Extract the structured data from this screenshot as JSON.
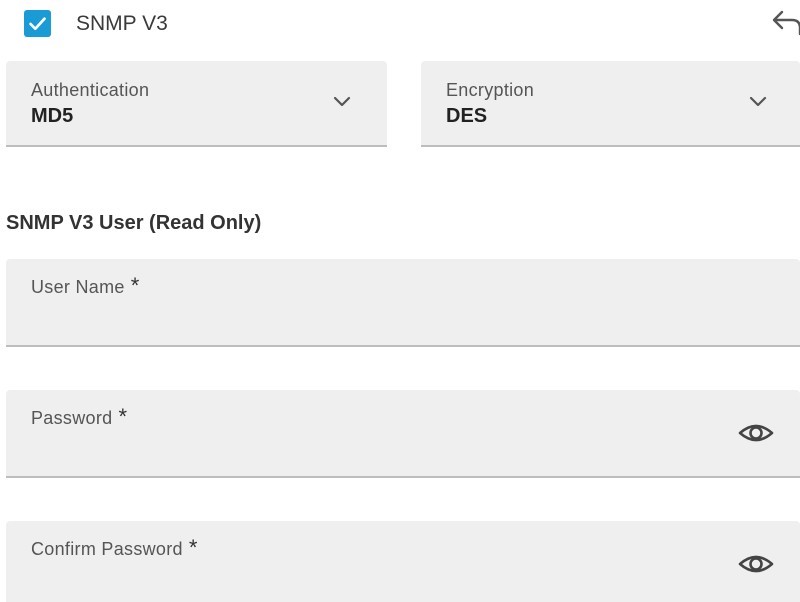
{
  "snmp_v3": {
    "label": "SNMP V3",
    "checked": true
  },
  "icons": {
    "check": "check-icon",
    "back": "back-arrow-icon",
    "chevron": "chevron-down-icon",
    "eye": "eye-icon"
  },
  "authentication": {
    "label": "Authentication",
    "value": "MD5"
  },
  "encryption": {
    "label": "Encryption",
    "value": "DES"
  },
  "section": {
    "title": "SNMP V3 User (Read Only)"
  },
  "fields": {
    "username": {
      "label": "User Name",
      "required": "*",
      "value": ""
    },
    "password": {
      "label": "Password",
      "required": "*",
      "value": ""
    },
    "confirm_password": {
      "label": "Confirm Password",
      "required": "*",
      "value": ""
    }
  },
  "colors": {
    "accent": "#1b9bd6",
    "field_bg": "#efefef",
    "underline": "#bdbdbd"
  }
}
